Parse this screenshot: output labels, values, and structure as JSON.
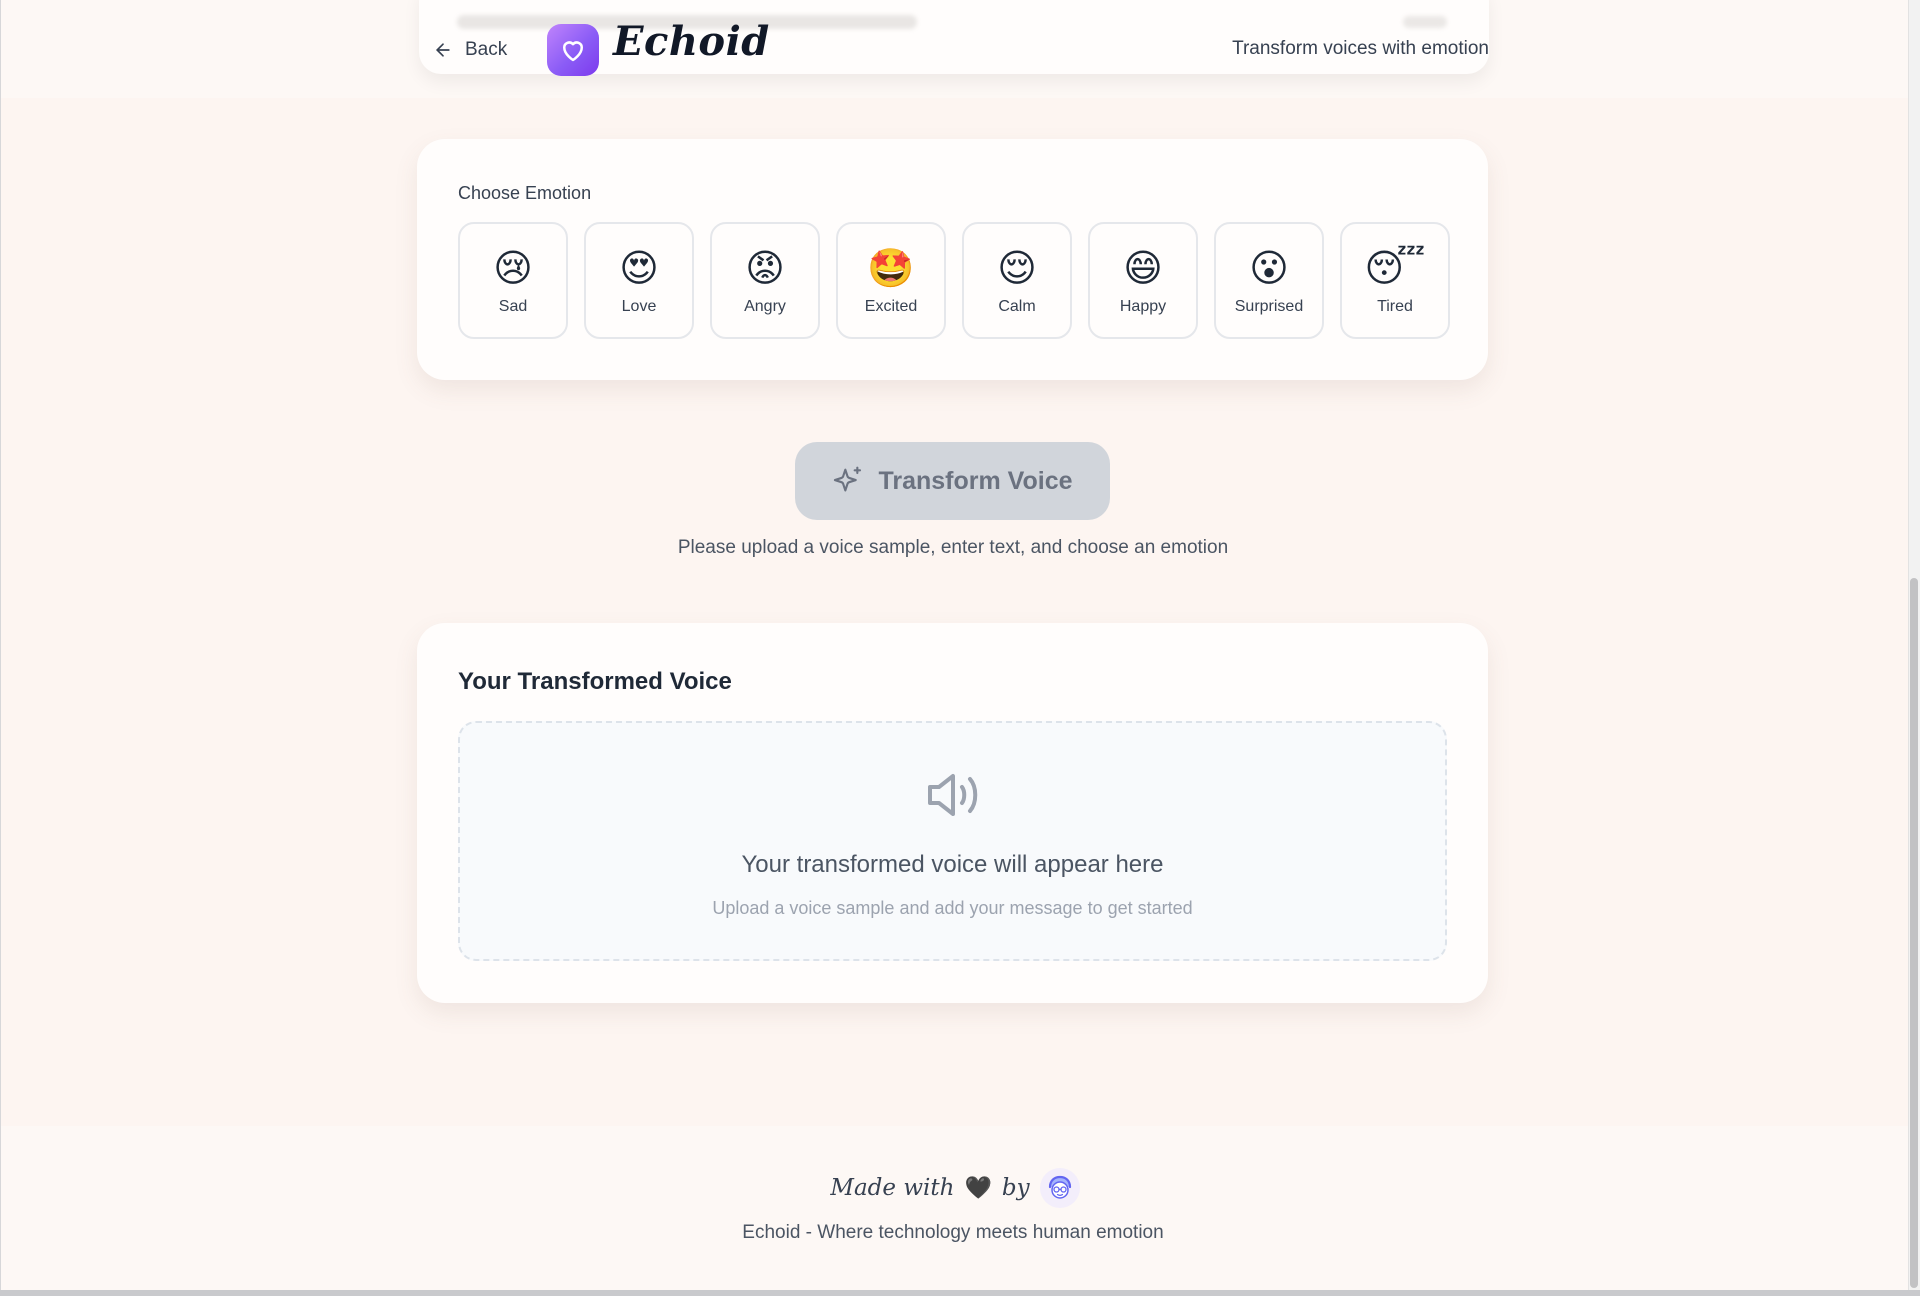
{
  "header": {
    "back_label": "Back",
    "brand": "Echoid",
    "tagline": "Transform voices with emotion"
  },
  "emotion_picker": {
    "title": "Choose Emotion",
    "emotions": [
      {
        "emoji": "😢",
        "label": "Sad"
      },
      {
        "emoji": "😍",
        "label": "Love"
      },
      {
        "emoji": "😡",
        "label": "Angry"
      },
      {
        "emoji": "🤩",
        "label": "Excited"
      },
      {
        "emoji": "😌",
        "label": "Calm"
      },
      {
        "emoji": "😄",
        "label": "Happy"
      },
      {
        "emoji": "😮",
        "label": "Surprised"
      },
      {
        "emoji": "😴",
        "label": "Tired"
      }
    ]
  },
  "transform": {
    "button_label": "Transform Voice",
    "hint": "Please upload a voice sample, enter text, and choose an emotion"
  },
  "output": {
    "title": "Your Transformed Voice",
    "empty_heading": "Your transformed voice will appear here",
    "empty_subtext": "Upload a voice sample and add your message to get started"
  },
  "footer": {
    "made_with": "Made with",
    "heart": "🖤",
    "by": "by",
    "tagline": "Echoid - Where technology meets human emotion"
  },
  "colors": {
    "page_bg": "#fdf5f1",
    "card_bg": "#fffdfc",
    "brand_gradient_start": "#c084fc",
    "brand_gradient_end": "#7c3aed",
    "button_disabled": "#d1d5db"
  }
}
